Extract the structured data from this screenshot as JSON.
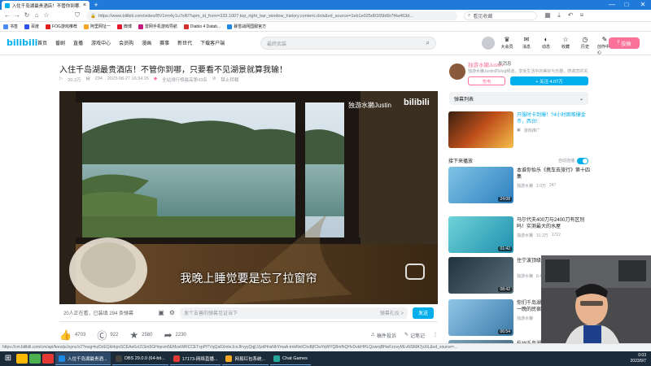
{
  "browser": {
    "tab_title": "入住千岛湖最贵酒店！不管你到哪...",
    "new_tab": "+",
    "url": "https://www.bilibili.com/video/BV1rm4y1u7xR/?spm_id_from=333.1007.top_right_bar_window_history.content.click&vd_source=1eb1e025d9165b6b7f4a463d...",
    "side_search_placeholder": "看见收藏",
    "bookmarks": [
      {
        "label": "书签",
        "color": "#4c8bf5"
      },
      {
        "label": "百度",
        "color": "#2f54eb"
      },
      {
        "label": "FOG游戏推荐",
        "color": "#e02020"
      },
      {
        "label": "阿里网址一",
        "color": "#f5a623"
      },
      {
        "label": "微博",
        "color": "#e6162d"
      },
      {
        "label": "雷网手机游戏导航",
        "color": "#c41d7f"
      },
      {
        "label": "Diablo 4 Datab...",
        "color": "#d32f2f"
      },
      {
        "label": "暴雪战网国服官方",
        "color": "#1e88e5"
      }
    ]
  },
  "bili_header": {
    "logo": "bilibili",
    "nav": [
      "首页",
      "番剧",
      "直播",
      "游戏中心",
      "会员购",
      "漫画",
      "赛事",
      "新世代",
      "下载客户端"
    ],
    "search_placeholder": "最终武装",
    "icons": [
      {
        "name": "大会员",
        "glyph": "♛"
      },
      {
        "name": "消息",
        "glyph": "✉"
      },
      {
        "name": "动态",
        "glyph": "◐"
      },
      {
        "name": "收藏",
        "glyph": "☆"
      },
      {
        "name": "历史",
        "glyph": "◷"
      },
      {
        "name": "创作中心",
        "glyph": "✎"
      }
    ],
    "upload": "投稿"
  },
  "video": {
    "title": "入住千岛湖最贵酒店！不管你到哪，只要看不见湖景就算我输！",
    "meta": [
      "20.3万",
      "294",
      "2023-08-27 16:34:26",
      "全站排行榜最高第43名",
      "禁止转载"
    ],
    "watermark": "独游水獭Justin",
    "subtitle": "我晚上睡觉要是忘了拉窗帘"
  },
  "danmaku_bar": {
    "watching": "20人正在看，已装填 294 条弹幕",
    "input_placeholder": "发个友善的弹幕见证当下",
    "etiquette": "弹幕礼仪 >",
    "send": "发送"
  },
  "actions": {
    "like": "4703",
    "coin": "922",
    "fav": "2580",
    "share": "2230",
    "report": "稿件投诉",
    "notes": "记笔记"
  },
  "uploader": {
    "name": "独游水獭Justin",
    "message": "发消息",
    "desc": "独游水獭Justin的vlog频道，享受生活中的美好与乐趣，感谢您的关注Justin",
    "charge": "充电",
    "follow": "+ 关注 4.07万"
  },
  "danmaku_list": {
    "label": "弹幕列表",
    "chevron": "⌄"
  },
  "recommend": {
    "ad_title": "开服时卡到爆！?4小时困难爆金币，西台!",
    "ad_sub": "游戏推广",
    "autoplay_label": "接下来播放",
    "autoplay_toggle": "自动连播",
    "items": [
      {
        "title": "本谁你怡乐《携车去旅行》第十四集",
        "up": "独游水獭",
        "plays": "2.0万",
        "danmaku": "247",
        "dur": "24:08"
      },
      {
        "title": "马尔代夫400刀与2400刀有区别吗！实测最大的水屋",
        "up": "独游水獭",
        "plays": "31.3万",
        "danmaku": "1712",
        "dur": "01:42"
      },
      {
        "title": "住宁波顶级酒店是什么体验?",
        "up": "独游水獭",
        "plays": "8.4万",
        "danmaku": "",
        "dur": "08:42"
      },
      {
        "title": "你们千岛湖去哪几天就好，8块钱一晚的民宿",
        "up": "独游水獭",
        "plays": "",
        "danmaku": "",
        "dur": "06:54"
      },
      {
        "title": "杭州千岛湖 ...三天两晚旅游",
        "up": "",
        "plays": "",
        "danmaku": "",
        "dur": ""
      }
    ]
  },
  "statusbar": "https://cm.bilibili.com/cm/api/fees/pc/sync/v2?msg=kzDzEQkIrkpxSCEAe6zU1Sm5GHnpvm5EMzsiWRCCETxpPITVqQa6XmkrJcoJfrvyyQqjLVjzdHnsNhYmaA-tmkNntChsBjfClwYqWYQ8mfhQHvDvkiHHLQzwrqBHwFzovyMLvNSMA7pXtL&vd_source=...",
  "taskbar": {
    "start": "⊞",
    "apps": [
      {
        "label": "入住千岛湖最贵酒...",
        "active": true
      },
      {
        "label": "OBS 29.0.0 (64-bit...",
        "active": false
      },
      {
        "label": "17173-网络直播...",
        "active": false
      },
      {
        "label": "网易红包系统...",
        "active": false
      },
      {
        "label": "Chat Games",
        "active": false
      }
    ],
    "time": "0:03",
    "date": "2023/9/7"
  }
}
